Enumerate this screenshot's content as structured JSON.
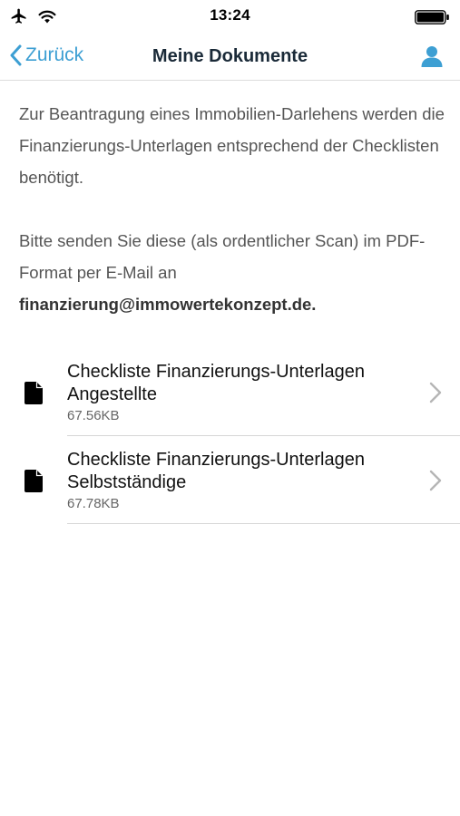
{
  "status_bar": {
    "time": "13:24",
    "airplane_icon": "airplane-icon",
    "wifi_icon": "wifi-icon",
    "battery_icon": "battery-icon",
    "battery_level": 1.0
  },
  "nav": {
    "back_label": "Zurück",
    "title": "Meine Dokumente",
    "profile_icon": "user-icon",
    "accent_color": "#3d9fd3"
  },
  "intro": {
    "line1": "Zur Beantragung eines Immobilien-Darlehens werden die Finanzierungs-Unterlagen entsprechend der Checklisten benötigt.",
    "line2": "Bitte senden Sie diese (als ordentlicher Scan) im PDF-Format per E-Mail an",
    "email": "finanzierung@immowertekonzept.de."
  },
  "documents": [
    {
      "title": "Checkliste Finanzierungs-Unterlagen Angestellte",
      "size": "67.56KB",
      "icon": "file-icon"
    },
    {
      "title": "Checkliste Finanzierungs-Unterlagen Selbstständige",
      "size": "67.78KB",
      "icon": "file-icon"
    }
  ]
}
